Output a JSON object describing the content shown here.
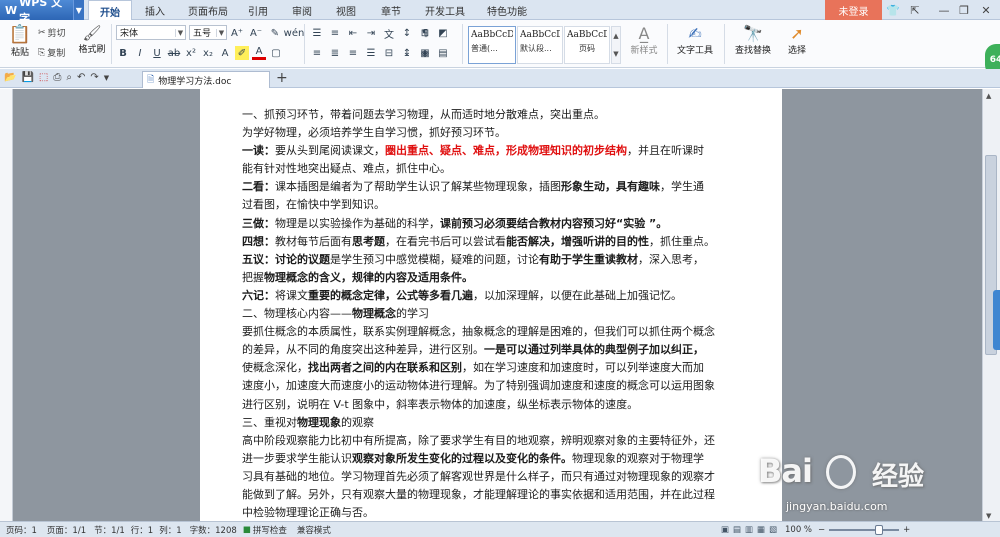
{
  "app": {
    "name": "WPS 文字"
  },
  "tabs": [
    "开始",
    "插入",
    "页面布局",
    "引用",
    "审阅",
    "视图",
    "章节",
    "开发工具",
    "特色功能"
  ],
  "login": "未登录",
  "ribbon": {
    "paste": "粘贴",
    "cut": "剪切",
    "copy": "复制",
    "format_painter": "格式刷",
    "font_name": "宋体",
    "font_size": "五号",
    "styles": [
      {
        "preview": "AaBbCcDd",
        "label": "普通(..."
      },
      {
        "preview": "AaBbCcDd",
        "label": "默认段..."
      },
      {
        "preview": "AaBbCcDd",
        "label": "页码"
      }
    ],
    "new_style": "新样式",
    "text_tools": "文字工具",
    "find_replace": "查找替换",
    "select": "选择"
  },
  "doc_tab": {
    "name": "物理学习方法.doc"
  },
  "document": {
    "p1": "一、抓预习环节，带着问题去学习物理，从而适时地分散难点，突出重点。",
    "p2": "为学好物理，必须培养学生自学习惯，抓好预习环节。",
    "p3a": "一读：",
    "p3b": "要从头到尾阅读课文，",
    "p3c": "圈出重点、疑点、难点，形成物理知识的初步结构",
    "p3d": "，并且在听课时",
    "p4": "能有针对性地突出疑点、难点，抓住中心。",
    "p5a": "二看：",
    "p5b": "课本插图是编者为了帮助学生认识了解某些物理现象，插图",
    "p5c": "形象生动，具有趣味",
    "p5d": "，学生通",
    "p6": "过看图，在愉快中学到知识。",
    "p7a": "三做：",
    "p7b": "物理是以实验操作为基础的科学，",
    "p7c": "课前预习必须要结合教材内容预习好“实验 ”。",
    "p8a": "四想：",
    "p8b": "教材每节后面有",
    "p8c": "思考题",
    "p8d": "，在看完书后可以尝试看",
    "p8e": "能否解决，增强听讲的目的性",
    "p8f": "，抓住重点。",
    "p9a": "五议：",
    "p9b": "讨论的议题",
    "p9c": "是学生预习中感觉模糊，疑难的问题，讨论",
    "p9d": "有助于学生重读教材",
    "p9e": "，深入思考，",
    "p10a": "把握",
    "p10b": "物理概念的含义，规律的内容及适用条件。",
    "p11a": "六记：",
    "p11b": "将课文",
    "p11c": "重要的概念定律，公式等多看几遍",
    "p11d": "，以加深理解，以便在此基础上加强记忆。",
    "p12a": "二、物理核心内容——",
    "p12b": "物理概念",
    "p12c": "的学习",
    "p13": "要抓住概念的本质属性，联系实例理解概念，抽象概念的理解是困难的，但我们可以抓住两个概念",
    "p14a": "的差异，从不同的角度突出这种差异，进行区别。",
    "p14b": "一是可以通过列举具体的典型例子加以纠正，",
    "p15a": "使概念深化，",
    "p15b": "找出两者之间的内在联系和区别",
    "p15c": "，如在学习速度和加速度时，可以列举速度大而加",
    "p16": "速度小，加速度大而速度小的运动物体进行理解。为了特别强调加速度和速度的概念可以运用图象",
    "p17": "进行区别，说明在 V-t 图象中，斜率表示物体的加速度，纵坐标表示物体的速度。",
    "p18a": "三、重视对",
    "p18b": "物理现象",
    "p18c": "的观察",
    "p19": "高中阶段观察能力比初中有所提高，除了要求学生有目的地观察，辨明观察对象的主要特征外，还",
    "p20a": "进一步要求学生能认识",
    "p20b": "观察对象所发生变化的过程以及变化的条件。",
    "p20c": "物理现象的观察对于物理学",
    "p21": "习具有基础的地位。学习物理首先必须了解客观世界是什么样子，而只有通过对物理现象的观察才",
    "p22": "能做到了解。另外，只有观察大量的物理现象，才能理解理论的事实依据和适用范围，并在此过程",
    "p23": "中检验物理理论正确与否。"
  },
  "status": {
    "page": "页码：1",
    "pages": "页面：1/1",
    "section": "节：1/1",
    "row": "行：1",
    "col": "列：1",
    "words": "字数：1208",
    "spell": "拼写检查",
    "compat": "兼容模式",
    "zoom": "100 %"
  },
  "watermark": {
    "brand": "Bai",
    "brand2": "经验",
    "url": "jingyan.baidu.com"
  },
  "badge": "64"
}
